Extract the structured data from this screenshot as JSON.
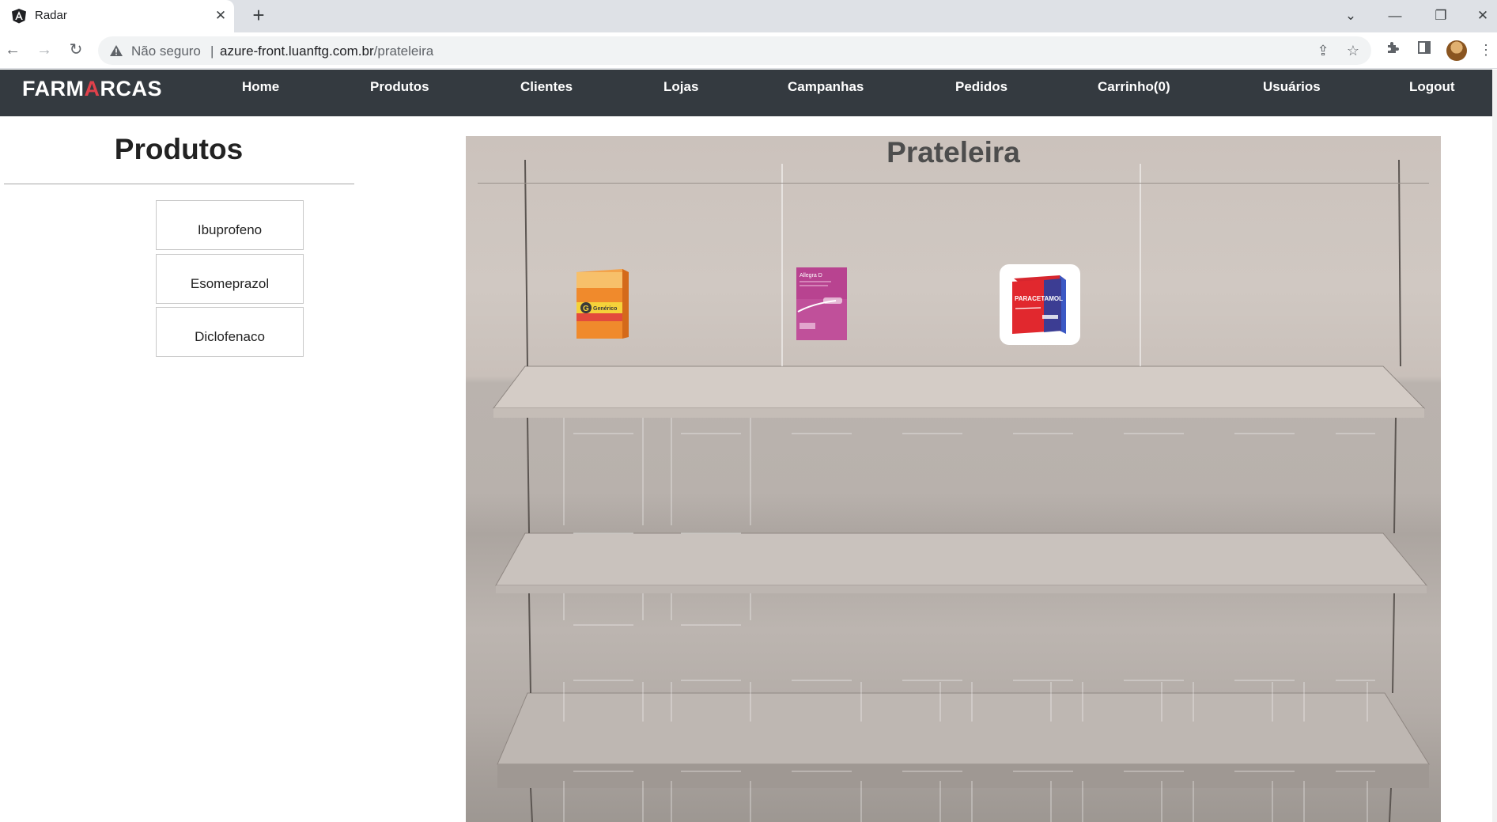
{
  "browser": {
    "tab_title": "Radar",
    "new_tab_icon": "plus-icon",
    "security_label": "Não seguro",
    "separator": "|",
    "url_host": "azure-front.luanftg.com.br",
    "url_path": "/prateleira"
  },
  "navbar": {
    "brand_part1": "FARM",
    "brand_part2": "A",
    "brand_part3": "RCAS",
    "links": [
      "Home",
      "Produtos",
      "Clientes",
      "Lojas",
      "Campanhas",
      "Pedidos",
      "Carrinho(0)",
      "Usuários",
      "Logout"
    ],
    "bg_color": "#343a40",
    "brand_accent": "#e0414b"
  },
  "sidebar": {
    "title": "Produtos",
    "products": [
      "Ibuprofeno",
      "Esomeprazol",
      "Diclofenaco"
    ]
  },
  "shelf": {
    "title": "Prateleira",
    "items": [
      {
        "name": "Ibuprofeno generico box",
        "box_label": "Genérico"
      },
      {
        "name": "Allegra D box",
        "box_label": "Allegra D"
      },
      {
        "name": "Paracetamol box",
        "box_label": "PARACETAMOL"
      }
    ]
  }
}
